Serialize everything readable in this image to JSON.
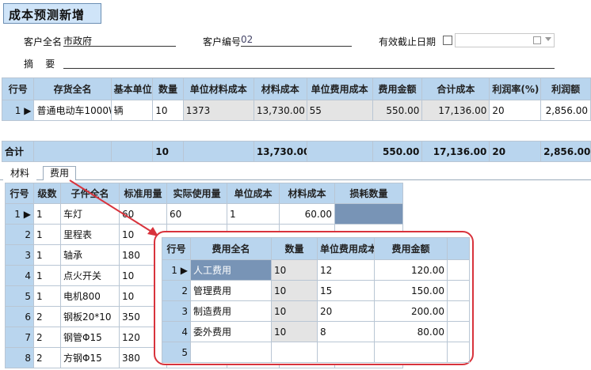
{
  "header": {
    "title": "成本预测新增"
  },
  "form": {
    "customer_name_label": "客户全名",
    "customer_name_value": "市政府",
    "customer_code_label": "客户编号",
    "customer_code_value": "02",
    "expiry_label": "有效截止日期",
    "summary_label": "摘    要"
  },
  "main_table": {
    "columns": [
      "行号",
      "存货全名",
      "基本单位",
      "数量",
      "单位材料成本",
      "材料成本",
      "单位费用成本",
      "费用金额",
      "合计成本",
      "利润率(%)",
      "利润额"
    ],
    "rows": [
      [
        "1",
        "普通电动车1000W",
        "辆",
        "10",
        "1373",
        "13,730.00",
        "55",
        "550.00",
        "17,136.00",
        "20",
        "2,856.00"
      ]
    ],
    "total": {
      "label": "合计",
      "qty": "10",
      "material": "13,730.00",
      "fee": "550.00",
      "total_cost": "17,136.00",
      "profit_rate": "20",
      "profit": "2,856.00"
    }
  },
  "tabs": [
    "材料",
    "费用"
  ],
  "material_table": {
    "columns": [
      "行号",
      "级数",
      "子件全名",
      "标准用量",
      "实际使用量",
      "单位成本",
      "材料成本",
      "损耗数量"
    ],
    "rows": [
      [
        "1",
        "1",
        "车灯",
        "60",
        "60",
        "1",
        "60.00",
        ""
      ],
      [
        "2",
        "1",
        "里程表",
        "10",
        "",
        "",
        "",
        ""
      ],
      [
        "3",
        "1",
        "轴承",
        "180",
        "",
        "",
        "",
        ""
      ],
      [
        "4",
        "1",
        "点火开关",
        "10",
        "",
        "",
        "",
        ""
      ],
      [
        "5",
        "1",
        "电机800",
        "10",
        "",
        "",
        "",
        ""
      ],
      [
        "6",
        "2",
        "钢板20*10",
        "350",
        "",
        "",
        "",
        ""
      ],
      [
        "7",
        "2",
        "钢管Φ15",
        "120",
        "",
        "",
        "",
        ""
      ],
      [
        "8",
        "2",
        "方钢Φ15",
        "380",
        "",
        "",
        "",
        ""
      ]
    ]
  },
  "fee_table": {
    "columns": [
      "行号",
      "费用全名",
      "数量",
      "单位费用成本",
      "费用金额"
    ],
    "rows": [
      [
        "1",
        "人工费用",
        "10",
        "12",
        "120.00"
      ],
      [
        "2",
        "管理费用",
        "10",
        "15",
        "150.00"
      ],
      [
        "3",
        "制造费用",
        "10",
        "20",
        "200.00"
      ],
      [
        "4",
        "委外费用",
        "10",
        "8",
        "80.00"
      ],
      [
        "5",
        "",
        "",
        "",
        ""
      ]
    ]
  }
}
